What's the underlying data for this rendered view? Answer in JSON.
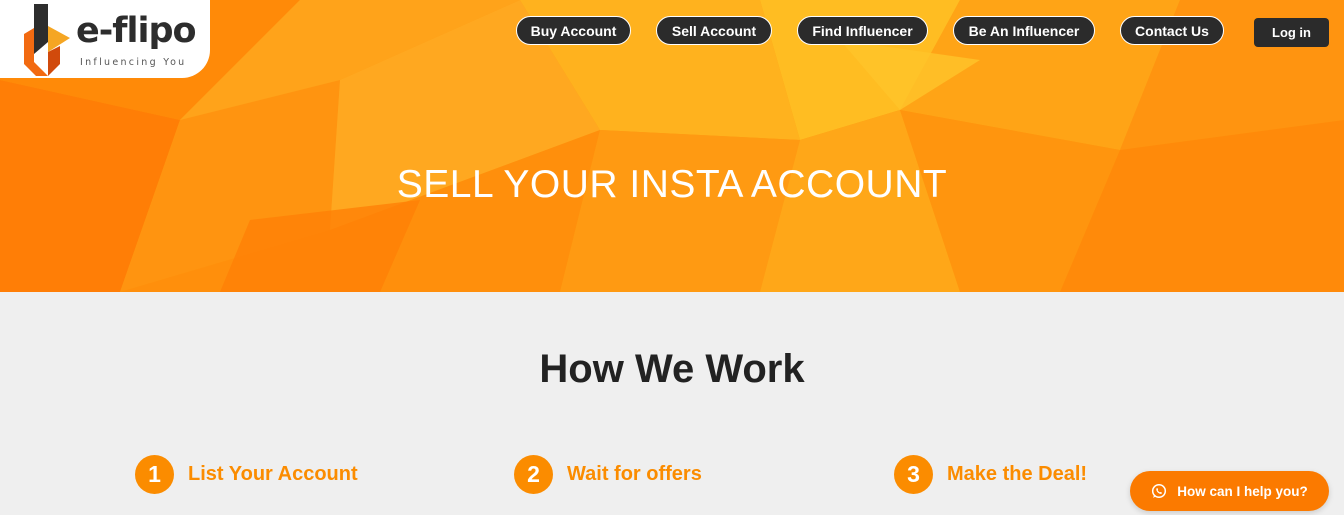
{
  "brand": {
    "name": "e-flipo",
    "tagline": "Influencing You"
  },
  "nav": {
    "items": [
      {
        "label": "Buy Account"
      },
      {
        "label": "Sell Account"
      },
      {
        "label": "Find Influencer"
      },
      {
        "label": "Be An Influencer"
      },
      {
        "label": "Contact Us"
      }
    ],
    "login_label": "Log in"
  },
  "hero": {
    "title": "SELL YOUR INSTA ACCOUNT"
  },
  "how_we_work": {
    "title": "How We Work",
    "steps": [
      {
        "number": "1",
        "label": "List Your Account"
      },
      {
        "number": "2",
        "label": "Wait for offers"
      },
      {
        "number": "3",
        "label": "Make the Deal!"
      }
    ]
  },
  "chat": {
    "label": "How can I help you?",
    "icon": "whatsapp-icon"
  },
  "colors": {
    "accent": "#fb8c00",
    "nav_button": "#2b2b2b",
    "section_bg": "#efefef"
  }
}
